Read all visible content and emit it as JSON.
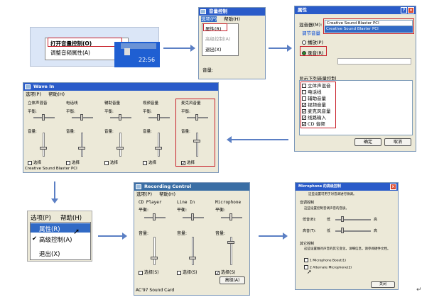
{
  "colors": {
    "accent": "#2a5bc9",
    "highlight": "#c8202a",
    "arrow": "#5b7fc4",
    "window_bg": "#ece9d8"
  },
  "tray": {
    "menu_open": "打开音量控制(O)",
    "menu_adjust": "调整音频属性(A)",
    "clock": "22:56"
  },
  "vol_window": {
    "title": "音量控制",
    "menu_options": "选项(P)",
    "menu_help": "帮助(H)",
    "dropdown_props": "属性(R)",
    "dropdown_advanced": "高级控制(A)",
    "dropdown_exit": "退出(X)",
    "volume_label": "音量:"
  },
  "props_dialog": {
    "title": "属性",
    "mixer_label": "混音器(M):",
    "mixer_value": "Creative Sound Blaster PCI",
    "mixer_option": "Creative Sound Blaster PCI",
    "adjust_label": "调节音量",
    "radio_playback": "播放(P)",
    "radio_record": "录音(R)",
    "list_label": "显示下列音量控制",
    "list_items": [
      {
        "label": "立体声混音",
        "checked": false
      },
      {
        "label": "电话线",
        "checked": false
      },
      {
        "label": "辅助音量",
        "checked": false
      },
      {
        "label": "视频音量",
        "checked": true
      },
      {
        "label": "麦克风音量",
        "checked": true
      },
      {
        "label": "线路输入",
        "checked": true
      },
      {
        "label": "CD 音频",
        "checked": true
      }
    ],
    "ok_btn": "确定",
    "cancel_btn": "取消"
  },
  "wave_in": {
    "title": "Wave In",
    "menu_options": "选项(P)",
    "menu_help": "帮助(H)",
    "balance_label": "平衡:",
    "volume_label": "音量:",
    "select_label": "选择",
    "channels": [
      {
        "name": "立体声混音",
        "selected": false
      },
      {
        "name": "电话线",
        "selected": false
      },
      {
        "name": "辅助音量",
        "selected": false
      },
      {
        "name": "视频音量",
        "selected": false
      },
      {
        "name": "麦克风音量",
        "selected": true
      }
    ],
    "status": "Creative Sound Blaster PCI"
  },
  "zoom_menu": {
    "options": "选项(P)",
    "help": "帮助(H)",
    "props": "属性(R)",
    "advanced": "高级控制(A)",
    "exit": "退出(X)"
  },
  "recording": {
    "title": "Recording Control",
    "menu_options": "选项(P)",
    "menu_help": "帮助(H)",
    "balance_label": "平衡:",
    "volume_label": "音量:",
    "select_label": "选择(S)",
    "advanced_btn": "高级(A)",
    "channels": [
      {
        "name": "CD Player",
        "selected": false
      },
      {
        "name": "Line In",
        "selected": false
      },
      {
        "name": "Microphone",
        "selected": true
      }
    ],
    "status": "AC'97 Sound Card"
  },
  "mic_adv": {
    "title": "Microphone 的高级控制",
    "intro": "这些设置可用于对音调进行微调。",
    "tone_section": "音调控制",
    "tone_desc": "这些设置控制音调声音的音质。",
    "bass": "低音(B):",
    "treble": "高音(T):",
    "low": "低",
    "high": "高",
    "other_section": "其它控制",
    "other_desc": "这些设置做对声音的其它变化，详细信息，请参阅硬件文档。",
    "boost": "1 Microphone Boost(1)",
    "alternate": "2 Alternate Microphone(2)",
    "close_btn": "关闭"
  }
}
